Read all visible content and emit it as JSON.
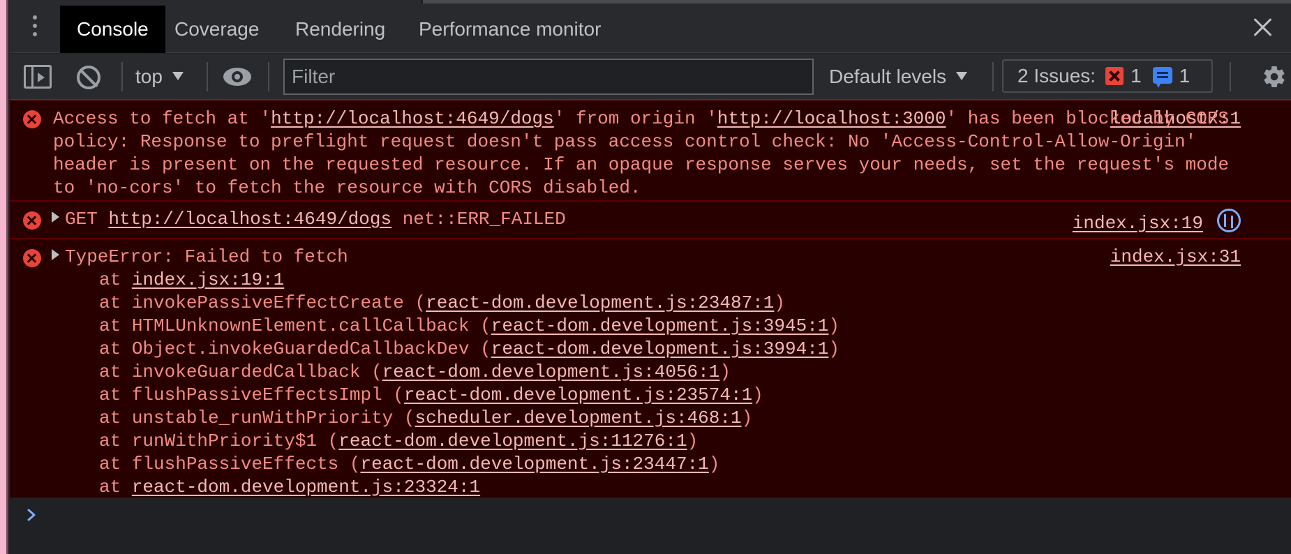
{
  "tabs": [
    "Console",
    "Coverage",
    "Rendering",
    "Performance monitor"
  ],
  "active_tab": "Console",
  "toolbar": {
    "context": "top",
    "filter_placeholder": "Filter",
    "levels": "Default levels",
    "issues_label": "2 Issues:",
    "issues_errors": "1",
    "issues_info": "1"
  },
  "messages": [
    {
      "level": "error",
      "line1_a": "Access to fetch at '",
      "url1": "http://localhost:4649/dogs",
      "line1_b": "' from origin '",
      "url2": "http://localhost:3000",
      "line1_c": "' has",
      "rest": "been blocked by CORS policy: Response to preflight request doesn't pass access control check: No 'Access-Control-Allow-Origin' header is present on the requested resource. If an opaque response serves your needs, set the request's mode to 'no-cors' to fetch the resource with CORS disabled.",
      "source": "localhost/:1"
    },
    {
      "level": "error",
      "method": "GET",
      "url": "http://localhost:4649/dogs",
      "status": "net::ERR_FAILED",
      "source": "index.jsx:19"
    },
    {
      "level": "error",
      "title": "TypeError: Failed to fetch",
      "source": "index.jsx:31",
      "stack": [
        {
          "fn": "",
          "loc": "index.jsx:19:1"
        },
        {
          "fn": "invokePassiveEffectCreate",
          "loc": "react-dom.development.js:23487:1"
        },
        {
          "fn": "HTMLUnknownElement.callCallback",
          "loc": "react-dom.development.js:3945:1"
        },
        {
          "fn": "Object.invokeGuardedCallbackDev",
          "loc": "react-dom.development.js:3994:1"
        },
        {
          "fn": "invokeGuardedCallback",
          "loc": "react-dom.development.js:4056:1"
        },
        {
          "fn": "flushPassiveEffectsImpl",
          "loc": "react-dom.development.js:23574:1"
        },
        {
          "fn": "unstable_runWithPriority",
          "loc": "scheduler.development.js:468:1"
        },
        {
          "fn": "runWithPriority$1",
          "loc": "react-dom.development.js:11276:1"
        },
        {
          "fn": "flushPassiveEffects",
          "loc": "react-dom.development.js:23447:1"
        },
        {
          "fn": "",
          "loc": "react-dom.development.js:23324:1"
        }
      ]
    }
  ],
  "prompt_symbol": "›"
}
